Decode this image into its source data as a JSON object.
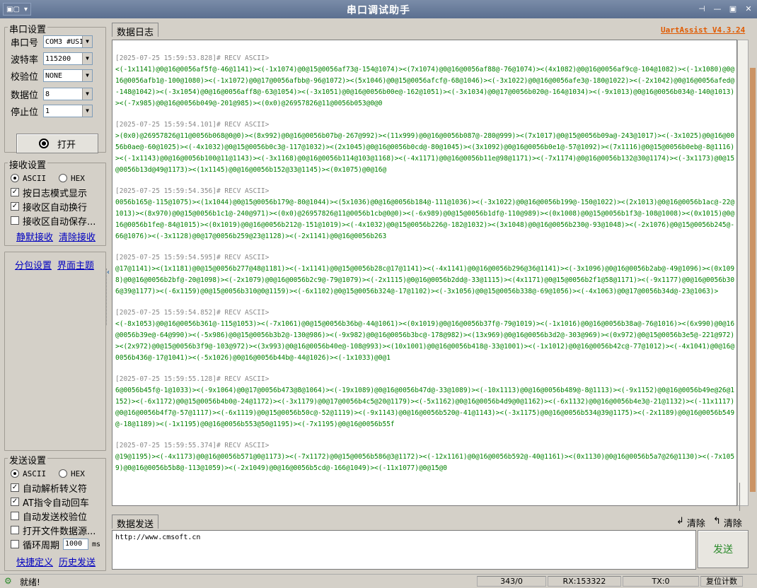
{
  "window": {
    "title": "串口调试助手"
  },
  "serial": {
    "title": "串口设置",
    "port_label": "串口号",
    "port_value": "COM3 #USI",
    "baud_label": "波特率",
    "baud_value": "115200",
    "parity_label": "校验位",
    "parity_value": "NONE",
    "databits_label": "数据位",
    "databits_value": "8",
    "stopbits_label": "停止位",
    "stopbits_value": "1",
    "open_label": "打开"
  },
  "recv": {
    "title": "接收设置",
    "ascii": "ASCII",
    "hex": "HEX",
    "log_mode": "按日志模式显示",
    "auto_wrap": "接收区自动换行",
    "auto_save": "接收区自动保存...",
    "silent": "静默接收",
    "clear": "清除接收"
  },
  "links": {
    "packet": "分包设置",
    "theme": "界面主题"
  },
  "send": {
    "title": "发送设置",
    "ascii": "ASCII",
    "hex": "HEX",
    "escape": "自动解析转义符",
    "at": "AT指令自动回车",
    "checksum": "自动发送校验位",
    "file": "打开文件数据源...",
    "cycle": "循环周期",
    "cycle_value": "1000",
    "cycle_unit": "ms",
    "quick": "快捷定义",
    "history": "历史发送"
  },
  "tabs": {
    "log": "数据日志",
    "send": "数据发送"
  },
  "brand": "UartAssist V4.3.24",
  "log": [
    {
      "head": "[2025-07-25 15:59:53.828]# RECV ASCII>",
      "data": "<(-1x1141)@0@16@0056af5f@-46@1141)><(-1x1074)@0@15@0056af73@-154@1074)><(7x1074)@0@16@0056af88@-76@1074)><(4x1082)@0@16@0056af9c@-104@1082)><(-1x1080)@0@16@0056afb1@-100@1080)><(-1x1072)@0@17@0056afbb@-96@1072)><(5x1046)@0@15@0056afcf@-68@1046)><(-3x1022)@0@16@0056afe3@-180@1022)><(-2x1042)@0@16@0056afed@-148@1042)><(-3x1054)@0@16@0056aff8@-63@1054)><(-3x1051)@0@16@0056b00e@-162@1051)><(-3x1034)@0@17@0056b020@-164@1034)><(-9x1013)@0@16@0056b034@-140@1013)><(-7x985)@0@16@0056b049@-201@985)><(0x0)@26957826@11@0056b053@0@0"
    },
    {
      "head": "[2025-07-25 15:59:54.101]# RECV ASCII>",
      "data": ">(0x0)@26957826@11@0056b068@0@0)><(8x992)@0@16@0056b07b@-267@992)><(11x999)@0@16@0056b087@-280@999)><(7x1017)@0@15@0056b09a@-243@1017)><(-3x1025)@0@16@0056b0ae@-60@1025)><(-4x1032)@0@15@0056b0c3@-117@1032)><(2x1045)@0@16@0056b0cd@-80@1045)><(3x1092)@0@16@0056b0e1@-57@1092)><(7x1116)@0@15@0056b0eb@-8@1116)><(-1x1143)@0@16@0056b100@11@1143)><(-3x1168)@0@16@0056b114@103@1168)><(-4x1171)@0@16@0056b11e@98@1171)><(-7x1174)@0@16@0056b132@30@1174)><(-3x1173)@0@15@0056b13d@49@1173)><(1x1145)@0@16@0056b152@33@1145)><(0x1075)@0@16@"
    },
    {
      "head": "[2025-07-25 15:59:54.356]# RECV ASCII>",
      "data": "0056b165@-115@1075)><(1x1044)@0@15@0056b179@-80@1044)><(5x1036)@0@16@0056b184@-111@1036)><(-3x1022)@0@16@0056b199@-150@1022)><(2x1013)@0@16@0056b1ac@-22@1013)><(8x970)@0@15@0056b1c1@-240@971)><(0x0)@26957826@11@0056b1cb@0@0)><(-6x989)@0@15@0056b1df@-110@989)><(0x1008)@0@15@0056b1f3@-108@1008)><(0x1015)@0@16@0056b1fe@-84@1015)><(0x1019)@0@16@0056b212@-151@1019)><(-4x1032)@0@15@0056b226@-182@1032)><(3x1048)@0@16@0056b230@-93@1048)><(-2x1076)@0@15@0056b245@-66@1076)><(-3x1128)@0@17@0056b259@23@1128)><(-2x1141)@0@16@0056b263"
    },
    {
      "head": "[2025-07-25 15:59:54.595]# RECV ASCII>",
      "data": "@17@1141)><(1x1181)@0@15@0056b277@48@1181)><(-1x1141)@0@15@0056b28c@17@1141)><(-4x1141)@0@16@0056b296@36@1141)><(-3x1096)@0@16@0056b2ab@-49@1096)><(0x1098)@0@16@0056b2bf@-20@1098)><(-2x1079)@0@16@0056b2c9@-79@1079)><(-2x1115)@0@16@0056b2dd@-33@1115)><(4x1171)@0@15@0056b2f1@58@1171)><(-9x1177)@0@16@0056b306@39@1177)><(-6x1159)@0@15@0056b310@0@1159)><(-6x1102)@0@15@0056b324@-17@1102)><(-3x1056)@0@15@0056b338@-69@1056)><(-4x1063)@0@17@0056b34d@-23@1063)>"
    },
    {
      "head": "[2025-07-25 15:59:54.852]# RECV ASCII>",
      "data": "<(-8x1053)@0@16@0056b361@-115@1053)><(-7x1061)@0@15@0056b36b@-44@1061)><(0x1019)@0@16@0056b37f@-79@1019)><(-1x1016)@0@16@0056b38a@-76@1016)><(6x990)@0@16@0056b39e@-64@990)><(-5x986)@0@15@0056b3b2@-130@986)><(-9x982)@0@16@0056b3bc@-178@982)><(13x969)@0@16@0056b3d2@-303@969)><(0x972)@0@15@0056b3e5@-221@972)><(2x972)@0@15@0056b3f9@-103@972)><(3x993)@0@16@0056b40e@-108@993)><(10x1001)@0@16@0056b418@-33@1001)><(-1x1012)@0@16@0056b42c@-77@1012)><(-4x1041)@0@16@0056b436@-17@1041)><(-5x1026)@0@16@0056b44b@-44@1026)><(-1x1033)@0@1"
    },
    {
      "head": "[2025-07-25 15:59:55.128]# RECV ASCII>",
      "data": "6@0056b45f@-1@1033)><(-9x1064)@0@17@0056b473@8@1064)><(-19x1089)@0@16@0056b47d@-33@1089)><(-10x1113)@0@16@0056b489@-8@1113)><(-9x1152)@0@16@0056b49e@26@1152)><(-6x1172)@0@15@0056b4b0@-24@1172)><(-3x1179)@0@17@0056b4c5@20@1179)><(-5x1162)@0@16@0056b4d9@0@1162)><(-6x1132)@0@16@0056b4e3@-21@1132)><(-11x1117)@0@16@0056b4f7@-57@1117)><(-6x1119)@0@15@0056b50c@-52@1119)><(-9x1143)@0@16@0056b520@-41@1143)><(-3x1175)@0@16@0056b534@39@1175)><(-2x1189)@0@16@0056b549@-18@1189)><(-1x1195)@0@16@0056b553@50@1195)><(-7x1195)@0@16@0056b55f"
    },
    {
      "head": "[2025-07-25 15:59:55.374]# RECV ASCII>",
      "data": "@19@1195)><(-4x1173)@0@16@0056b571@0@1173)><(-7x1172)@0@15@0056b586@3@1172)><(-12x1161)@0@16@0056b592@-40@1161)><(0x1130)@0@16@0056b5a7@26@1130)><(-7x1059)@0@16@0056b5b8@-113@1059)><(-2x1049)@0@16@0056b5cd@-166@1049)><(-11x1077)@0@15@0"
    }
  ],
  "sendarea": {
    "text": "http://www.cmsoft.cn",
    "send_label": "发送",
    "clear1": "清除",
    "clear2": "清除"
  },
  "status": {
    "ready": "就绪!",
    "count": "343/0",
    "rx": "RX:153322",
    "tx": "TX:0",
    "reset": "复位计数"
  }
}
